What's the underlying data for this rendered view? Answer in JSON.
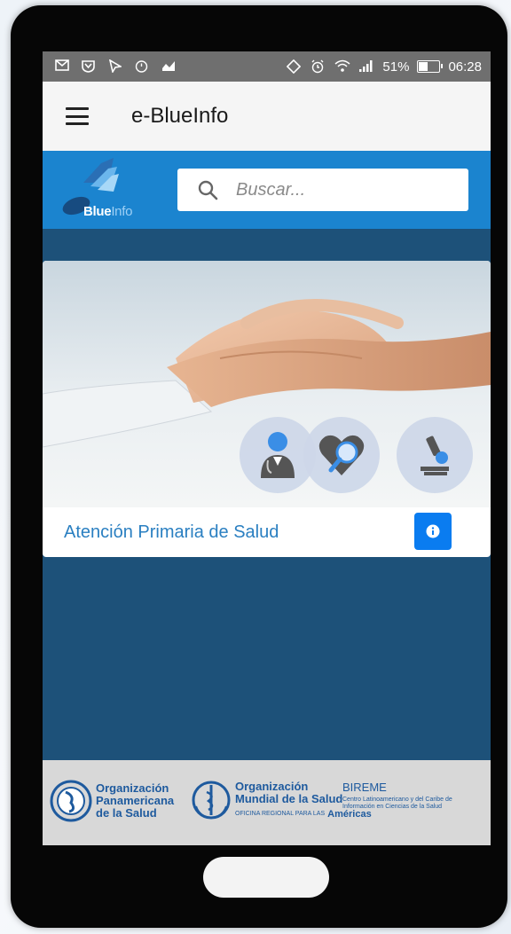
{
  "status_bar": {
    "battery_percent": "51%",
    "battery_level": 0.51,
    "time": "06:28",
    "left_icons": [
      "mail-icon",
      "shield-icon",
      "cursor-icon",
      "timer-icon",
      "share-icon"
    ],
    "right_icons": [
      "vibrate-icon",
      "alarm-icon",
      "wifi-icon",
      "signal-icon",
      "battery-icon"
    ]
  },
  "app_bar": {
    "title": "e-BlueInfo",
    "menu_icon": "hamburger-icon"
  },
  "search_header": {
    "logo_text_blue": "Blue",
    "logo_text_info": "Info",
    "search_placeholder": "Buscar...",
    "search_value": ""
  },
  "card": {
    "title": "Atención Primaria de Salud",
    "info_label": "i",
    "image_icons": [
      "doctor-icon",
      "heart-search-icon",
      "microscope-icon"
    ]
  },
  "footer": {
    "paho": {
      "line1": "Organización",
      "line2": "Panamericana",
      "line3": "de la Salud"
    },
    "who": {
      "line1": "Organización",
      "line2": "Mundial de la Salud",
      "small": "OFICINA REGIONAL PARA LAS",
      "region": "Américas"
    },
    "bireme": {
      "name": "BIREME",
      "line1": "Centro Latinoamericano y del Caribe de",
      "line2": "Información en Ciencias de la Salud"
    }
  },
  "colors": {
    "status_bar": "#6f6f6f",
    "app_bar": "#f5f5f5",
    "search_band": "#1b84cf",
    "background": "#1d5179",
    "info_button": "#0a7cf0",
    "card_title": "#2a7fc1",
    "footer": "#d8d8d8"
  }
}
